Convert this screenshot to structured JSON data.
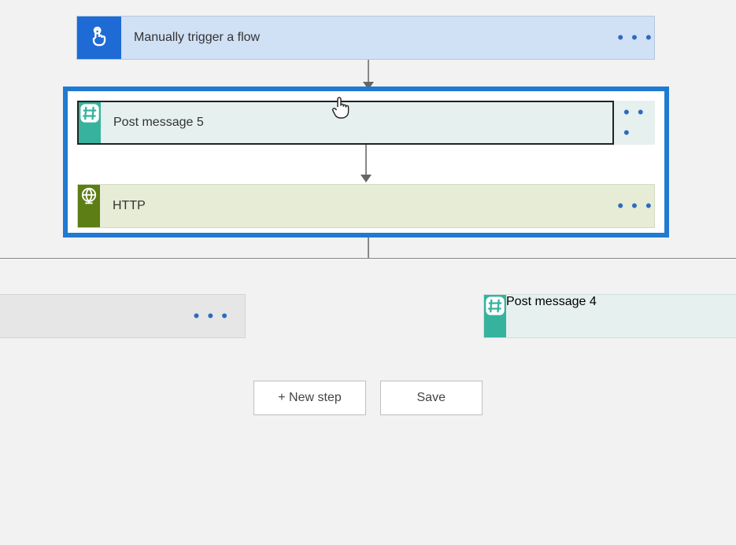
{
  "trigger": {
    "label": "Manually trigger a flow"
  },
  "selection": {
    "post5": {
      "label": "Post message 5"
    },
    "http": {
      "label": "HTTP"
    }
  },
  "branches": {
    "right": {
      "label": "Post message 4"
    }
  },
  "buttons": {
    "new_step": "+ New step",
    "save": "Save"
  },
  "menu_glyph": "• • •"
}
